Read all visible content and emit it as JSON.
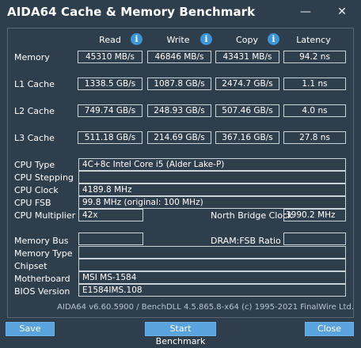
{
  "window": {
    "title": "AIDA64 Cache & Memory Benchmark",
    "minimize_label": "—",
    "close_label": "✕"
  },
  "columns": {
    "read": "Read",
    "write": "Write",
    "copy": "Copy",
    "latency": "Latency",
    "info_glyph": "i"
  },
  "rows": {
    "memory": {
      "label": "Memory",
      "read": "45310 MB/s",
      "write": "46846 MB/s",
      "copy": "43431 MB/s",
      "latency": "94.2 ns"
    },
    "l1": {
      "label": "L1 Cache",
      "read": "1338.5 GB/s",
      "write": "1087.8 GB/s",
      "copy": "2474.7 GB/s",
      "latency": "1.1 ns"
    },
    "l2": {
      "label": "L2 Cache",
      "read": "749.74 GB/s",
      "write": "248.93 GB/s",
      "copy": "507.46 GB/s",
      "latency": "4.0 ns"
    },
    "l3": {
      "label": "L3 Cache",
      "read": "511.18 GB/s",
      "write": "214.69 GB/s",
      "copy": "367.16 GB/s",
      "latency": "27.8 ns"
    }
  },
  "system": {
    "cpu_type": {
      "label": "CPU Type",
      "value": "4C+8c Intel Core i5  (Alder Lake-P)"
    },
    "cpu_stepping": {
      "label": "CPU Stepping",
      "value": ""
    },
    "cpu_clock": {
      "label": "CPU Clock",
      "value": "4189.8 MHz"
    },
    "cpu_fsb": {
      "label": "CPU FSB",
      "value": "99.8 MHz  (original: 100 MHz)"
    },
    "cpu_multiplier": {
      "label": "CPU Multiplier",
      "value": "42x"
    },
    "north_bridge_clock": {
      "label": "North Bridge Clock",
      "value": "3990.2 MHz"
    },
    "memory_bus": {
      "label": "Memory Bus",
      "value": ""
    },
    "dram_fsb_ratio": {
      "label": "DRAM:FSB Ratio",
      "value": ""
    },
    "memory_type": {
      "label": "Memory Type",
      "value": ""
    },
    "chipset": {
      "label": "Chipset",
      "value": ""
    },
    "motherboard": {
      "label": "Motherboard",
      "value": "MSI MS-1584"
    },
    "bios_version": {
      "label": "BIOS Version",
      "value": "E1584IMS.108"
    }
  },
  "footer": {
    "text": "AIDA64 v6.60.5900 / BenchDLL 4.5.865.8-x64  (c) 1995-2021 FinalWire Ltd."
  },
  "buttons": {
    "save": "Save",
    "start": "Start Benchmark",
    "close": "Close"
  }
}
